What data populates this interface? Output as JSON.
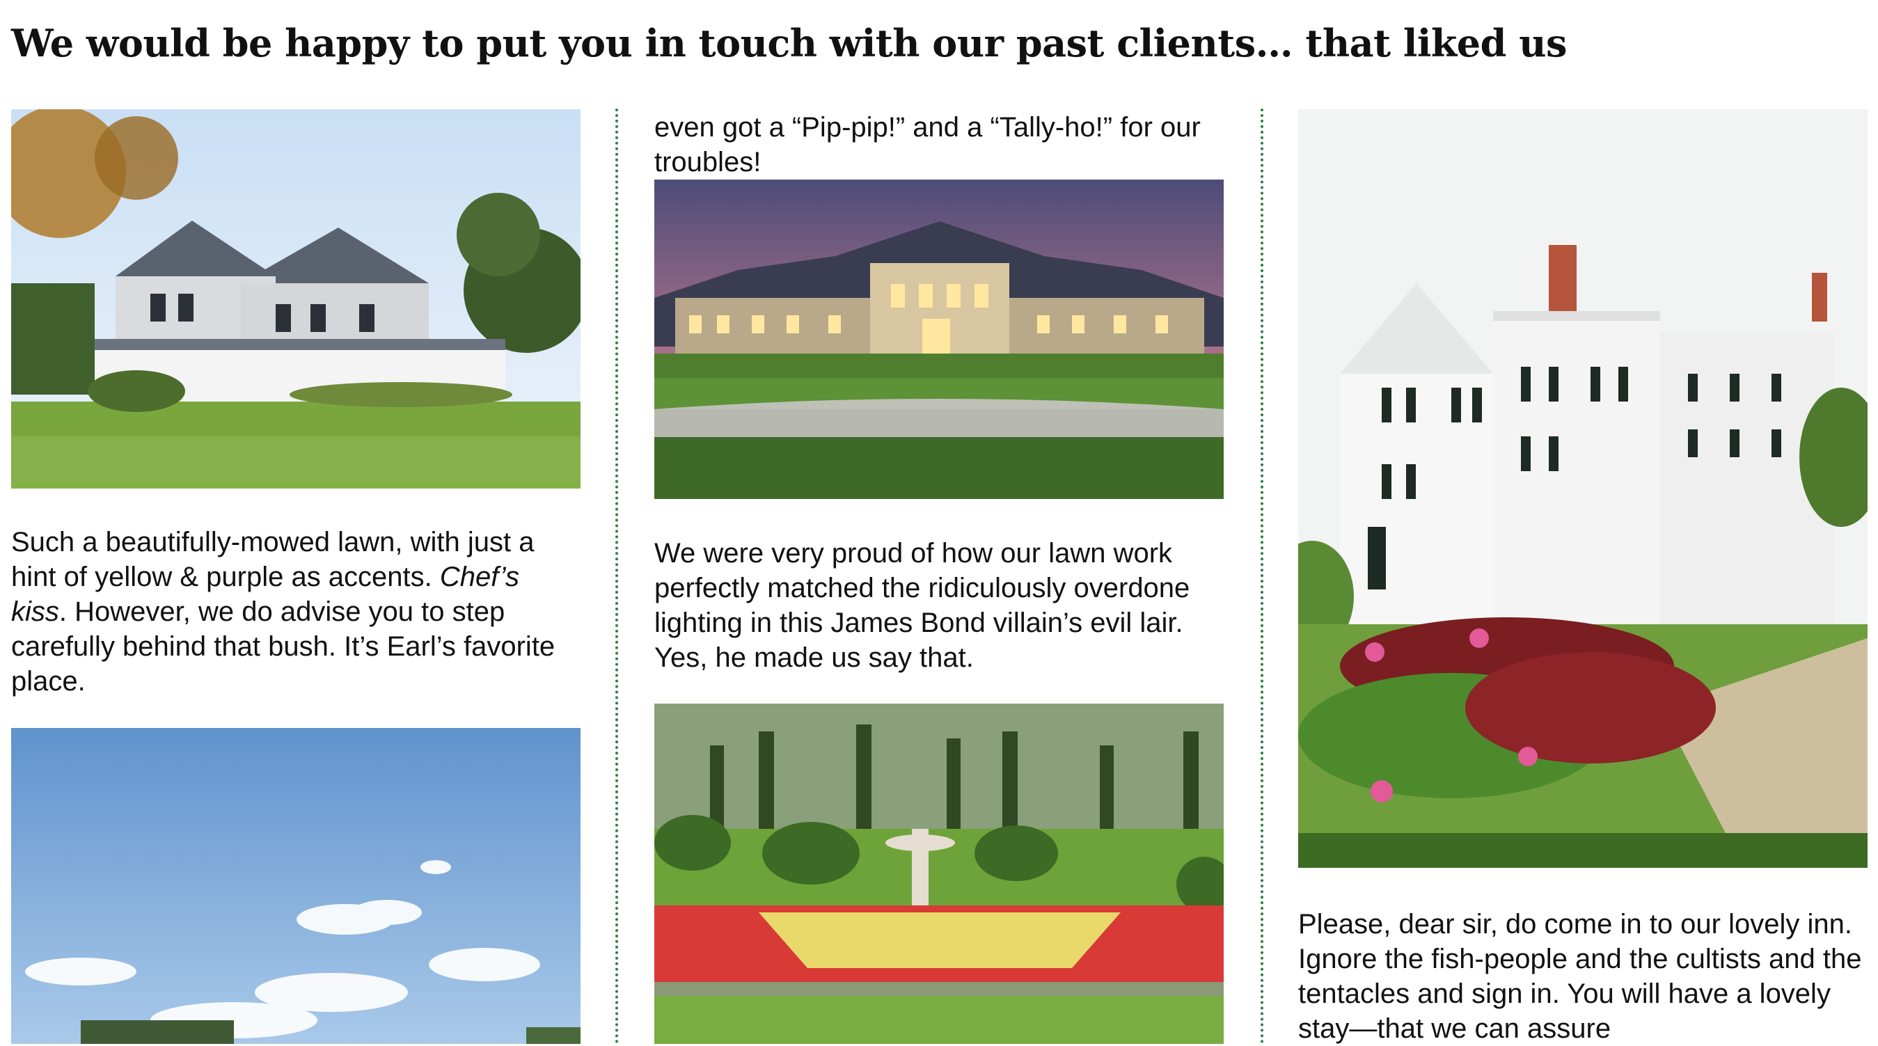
{
  "heading": "We would be happy to put you in touch with our past clients… that liked us",
  "columns": [
    {
      "caption_1_before": "Such a beautifully-mowed lawn, with just a hint of yellow & purple as accents. ",
      "caption_1_emphasis": "Chef’s kiss",
      "caption_1_after": ". However, we do advise you to step carefully behind that bush. It’s Earl’s favorite place."
    },
    {
      "caption_top": "even got a “Pip-pip!” and a “Tally-ho!” for our troubles!",
      "caption_2": "We were very proud of how our lawn work perfectly matched the ridiculously overdone lighting in this James Bond villain’s evil lair. Yes, he made us say that."
    },
    {
      "caption_3": "Please, dear sir, do come in to our lovely inn. Ignore the fish-people and the cultists and the tentacles and sign in. You will have a lovely stay—that we can assure"
    }
  ],
  "colors": {
    "divider": "#2e7d44",
    "lawn": "#6fa23a",
    "sky": "#cfe2f2"
  }
}
